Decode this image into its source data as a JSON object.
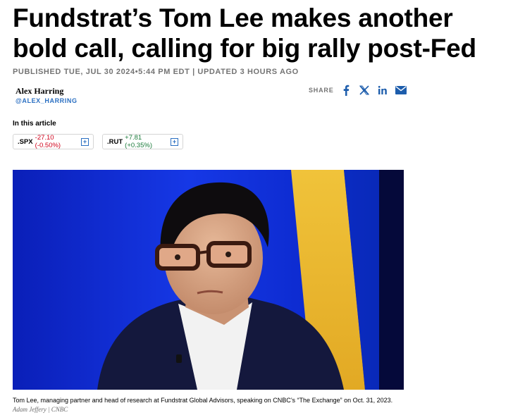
{
  "article": {
    "headline": "Fundstrat’s Tom Lee makes another bold call, calling for big rally post-Fed",
    "published": "PUBLISHED TUE, JUL 30 2024•5:44 PM EDT | UPDATED 3 HOURS AGO"
  },
  "author": {
    "name": "Alex Harring",
    "handle": "@ALEX_HARRING"
  },
  "share": {
    "label": "SHARE",
    "icons": [
      "facebook-icon",
      "x-icon",
      "linkedin-icon",
      "email-icon"
    ]
  },
  "in_article": {
    "label": "In this article",
    "quotes": [
      {
        "ticker": ".SPX",
        "change": "-27.10 (-0.50%)",
        "direction": "down",
        "color": "#d0021b"
      },
      {
        "ticker": ".RUT",
        "change": "+7.81 (+0.35%)",
        "direction": "up",
        "color": "#1a7a3a"
      }
    ],
    "add_icon": "plus-icon"
  },
  "image": {
    "caption": "Tom Lee, managing partner and head of research at Fundstrat Global Advisors, speaking on CNBC’s “The Exchange” on Oct. 31, 2023.",
    "credit": "Adam Jeffery | CNBC"
  },
  "colors": {
    "link_blue": "#2a6fc2",
    "icon_blue": "#1d5dac",
    "negative": "#d0021b",
    "positive": "#1a7a3a",
    "meta_gray": "#747474"
  }
}
